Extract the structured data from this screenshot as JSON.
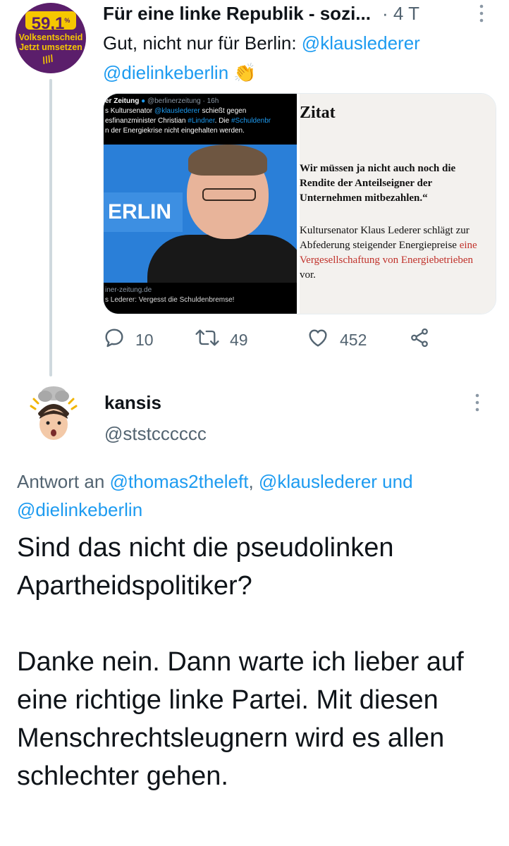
{
  "tweet": {
    "avatar": {
      "number": "59,1",
      "percent": "%",
      "line1": "Volksentscheid",
      "line2": "Jetzt umsetzen",
      "background": "#5b1e6b",
      "accent": "#f6c700"
    },
    "display_name": "Für eine linke Republik - sozi...",
    "time": "· 4 T",
    "more_icon": "more-vertical-icon",
    "text_prefix": "Gut, nicht nur für Berlin: ",
    "mention1": "@klauslederer",
    "mention2": "@dielinkeberlin",
    "emoji": "👏",
    "media_left": {
      "source_name": "er Zeitung",
      "source_handle": "@berlinerzeitung · 16h",
      "line1_a": "s Kultursenator ",
      "line1_mention": "@klauslederer",
      "line1_b": " schießt gegen",
      "line2_a": "esfinanzminister Christian ",
      "line2_hashtag": "#Lindner",
      "line2_b": ". Die ",
      "line2_hashtag2": "#Schuldenbr",
      "line3": "n der Energiekrise nicht eingehalten werden.",
      "sign_text": "ERLIN",
      "caption_domain": "iner-zeitung.de",
      "caption_title": "s Lederer: Vergesst die Schuldenbremse!"
    },
    "media_right": {
      "heading": "Zitat",
      "quote_lines": [
        "Wir müssen ja nicht auch noch die",
        "Rendite der Anteilseigner der",
        "Unternehmen mitbezahlen.“"
      ],
      "body_line1": "Kultursenator Klaus Lederer schlägt zur",
      "body_line2_a": "Abfederung steigender Energiepreise ",
      "body_line2_red": "eine",
      "body_line3_red": "Vergesellschaftung von Energiebetrieben",
      "body_line4": "vor."
    },
    "actions": {
      "replies": "10",
      "retweets": "49",
      "likes": "452"
    }
  },
  "reply": {
    "display_name": "kansis",
    "handle": "@ststcccccc",
    "reply_to_prefix": "Antwort an ",
    "reply_to_mention1": "@thomas2theleft",
    "reply_to_sep": ", ",
    "reply_to_mention2": "@klauslederer",
    "reply_to_and": " und",
    "reply_to_mention3": "@dielinkeberlin",
    "paragraph1": "Sind das nicht die pseudolinken Apartheidspolitiker?",
    "paragraph2": "Danke nein. Dann warte ich lieber auf eine richtige linke Partei. Mit diesen Menschrechtsleugnern wird es allen schlechter gehen."
  },
  "colors": {
    "link": "#1d9bf0",
    "secondary_text": "#536471",
    "thread_line": "#cfd9de"
  }
}
